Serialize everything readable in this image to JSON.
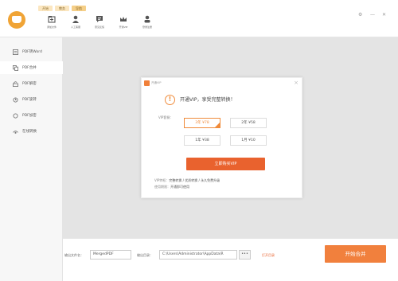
{
  "colors": {
    "accent": "#f1803d",
    "button": "#e9622e",
    "logo": "#f0a436",
    "tab_bg": "#fbe6bf"
  },
  "toolbar": {
    "tabs": [
      {
        "label": "开始"
      },
      {
        "label": "教务"
      },
      {
        "label": "导航"
      }
    ],
    "tools": [
      {
        "label": "添加文件",
        "icon": "add-file-icon"
      },
      {
        "label": "人工客服",
        "icon": "customer-service-icon"
      },
      {
        "label": "意见反馈",
        "icon": "feedback-icon"
      },
      {
        "label": "开通VIP",
        "icon": "vip-crown-icon"
      },
      {
        "label": "登录注册",
        "icon": "user-icon"
      }
    ]
  },
  "sidebar": {
    "items": [
      {
        "label": "PDF转Word",
        "icon": "word-icon"
      },
      {
        "label": "PDF合并",
        "icon": "merge-icon"
      },
      {
        "label": "PDF解密",
        "icon": "unlock-icon"
      },
      {
        "label": "PDF旋转",
        "icon": "rotate-icon"
      },
      {
        "label": "PDF加密",
        "icon": "lock-icon"
      },
      {
        "label": "在线转换",
        "icon": "online-icon"
      }
    ]
  },
  "dialog": {
    "title": "开通VIP",
    "message": "开通VIP，享受完整转换！",
    "packages_label": "VIP套餐：",
    "packages": [
      {
        "label": "3年  ¥78",
        "selected": true
      },
      {
        "label": "2年  ¥58",
        "selected": false
      },
      {
        "label": "1年  ¥38",
        "selected": false
      },
      {
        "label": "1月  ¥10",
        "selected": false
      }
    ],
    "buy_button": "立即购买VIP",
    "privileges": [
      {
        "label": "VIP特权：",
        "value": "完整转换 / 优质转换 / 永久免费升级"
      },
      {
        "label": "使用期限：",
        "value": "开通即可使用"
      }
    ]
  },
  "bottom": {
    "filename_label": "输出文件名：",
    "filename_value": "MergedPDF",
    "output_label": "输出目录：",
    "output_value": "C:\\Users\\Administrator\\AppData\\R",
    "browse": "•••",
    "open_dir_link": "打开目录",
    "start_button": "开始合并"
  }
}
